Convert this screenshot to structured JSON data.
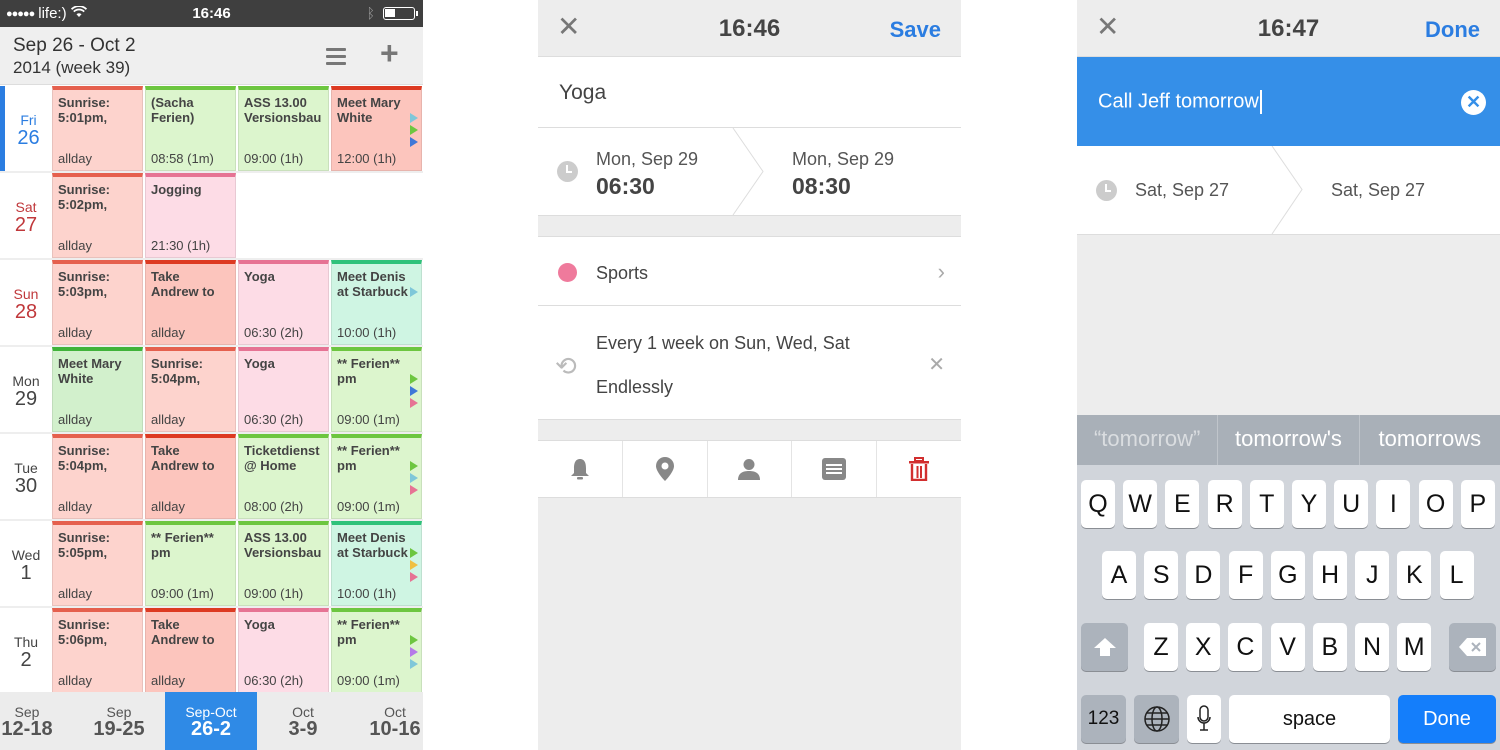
{
  "calendar": {
    "status_bar": {
      "carrier": "life:)",
      "signal": "●●●●●",
      "time": "16:46"
    },
    "header": {
      "range": "Sep 26 - Oct 2",
      "year_week": "2014 (week 39)"
    },
    "days": [
      {
        "dow": "Fri",
        "num": "26",
        "style": "today",
        "events": [
          {
            "title": "Sunrise:\n5:01pm,",
            "time": "allday",
            "color": "red"
          },
          {
            "title": "(Sacha\nFerien)",
            "time": "08:58 (1m)",
            "color": "green"
          },
          {
            "title": "ASS 13.00\nVersionsbau",
            "time": "09:00 (1h)",
            "color": "green"
          },
          {
            "title": "Meet Mary\nWhite",
            "time": "12:00 (1h)",
            "color": "redd"
          }
        ],
        "more": [
          "#7fc7d9",
          "#6dc640",
          "#3f78d8"
        ]
      },
      {
        "dow": "Sat",
        "num": "27",
        "style": "weekend",
        "events": [
          {
            "title": "Sunrise:\n5:02pm,",
            "time": "allday",
            "color": "red"
          },
          {
            "title": "Jogging",
            "time": "21:30 (1h)",
            "color": "pink"
          }
        ],
        "more": []
      },
      {
        "dow": "Sun",
        "num": "28",
        "style": "weekend",
        "events": [
          {
            "title": "Sunrise:\n5:03pm,",
            "time": "allday",
            "color": "red"
          },
          {
            "title": "Take\nAndrew to",
            "time": "allday",
            "color": "redd"
          },
          {
            "title": "Yoga",
            "time": "06:30 (2h)",
            "color": "pink"
          },
          {
            "title": "Meet Denis\nat Starbuck",
            "time": "10:00 (1h)",
            "color": "teal"
          }
        ],
        "more": [
          "#7fc7d9"
        ]
      },
      {
        "dow": "Mon",
        "num": "29",
        "style": "normal",
        "events": [
          {
            "title": "Meet Mary\nWhite",
            "time": "allday",
            "color": "greend"
          },
          {
            "title": "Sunrise:\n5:04pm,",
            "time": "allday",
            "color": "red"
          },
          {
            "title": "Yoga",
            "time": "06:30 (2h)",
            "color": "pink"
          },
          {
            "title": "** Ferien**\npm",
            "time": "09:00 (1m)",
            "color": "green"
          }
        ],
        "more": [
          "#6dc640",
          "#3f78d8",
          "#e67394"
        ]
      },
      {
        "dow": "Tue",
        "num": "30",
        "style": "normal",
        "events": [
          {
            "title": "Sunrise:\n5:04pm,",
            "time": "allday",
            "color": "red"
          },
          {
            "title": "Take\nAndrew to",
            "time": "allday",
            "color": "redd"
          },
          {
            "title": "Ticketdienst\n@ Home",
            "time": "08:00 (2h)",
            "color": "green"
          },
          {
            "title": "** Ferien**\npm",
            "time": "09:00 (1m)",
            "color": "green"
          }
        ],
        "more": [
          "#6dc640",
          "#7fc7d9",
          "#e67394"
        ]
      },
      {
        "dow": "Wed",
        "num": "1",
        "style": "normal",
        "events": [
          {
            "title": "Sunrise:\n5:05pm,",
            "time": "allday",
            "color": "red"
          },
          {
            "title": "** Ferien**\npm",
            "time": "09:00 (1m)",
            "color": "green"
          },
          {
            "title": "ASS 13.00\nVersionsbau",
            "time": "09:00 (1h)",
            "color": "green"
          },
          {
            "title": "Meet Denis\nat Starbuck",
            "time": "10:00 (1h)",
            "color": "teal"
          }
        ],
        "more": [
          "#6dc640",
          "#f0c040",
          "#e67394"
        ]
      },
      {
        "dow": "Thu",
        "num": "2",
        "style": "normal",
        "events": [
          {
            "title": "Sunrise:\n5:06pm,",
            "time": "allday",
            "color": "red"
          },
          {
            "title": "Take\nAndrew to",
            "time": "allday",
            "color": "redd"
          },
          {
            "title": "Yoga",
            "time": "06:30 (2h)",
            "color": "pink"
          },
          {
            "title": "** Ferien**\npm",
            "time": "09:00 (1m)",
            "color": "green"
          }
        ],
        "more": [
          "#6dc640",
          "#b57be8",
          "#7fc7d9"
        ]
      }
    ],
    "weeks": [
      {
        "month": "Sep",
        "range": "12-18",
        "selected": false
      },
      {
        "month": "Sep",
        "range": "19-25",
        "selected": false
      },
      {
        "month": "Sep-Oct",
        "range": "26-2",
        "selected": true
      },
      {
        "month": "Oct",
        "range": "3-9",
        "selected": false
      },
      {
        "month": "Oct",
        "range": "10-16",
        "selected": false
      }
    ]
  },
  "edit_event": {
    "title_bar": {
      "time": "16:46",
      "action": "Save"
    },
    "title": "Yoga",
    "start": {
      "date": "Mon, Sep 29",
      "time": "06:30"
    },
    "end": {
      "date": "Mon, Sep 29",
      "time": "08:30"
    },
    "category": {
      "label": "Sports",
      "color": "#ef7a9c"
    },
    "repeat": {
      "line1": "Every 1 week on Sun, Wed, Sat",
      "line2": "Endlessly"
    },
    "toolbar": [
      "bell",
      "location",
      "person",
      "notes",
      "trash"
    ]
  },
  "new_event": {
    "title_bar": {
      "time": "16:47",
      "action": "Done"
    },
    "title_input": "Call Jeff tomorrow",
    "start": {
      "date": "Sat, Sep 27"
    },
    "end": {
      "date": "Sat, Sep 27"
    },
    "suggestions": [
      "“tomorrow”",
      "tomorrow's",
      "tomorrows"
    ],
    "keyboard": {
      "row1": [
        "Q",
        "W",
        "E",
        "R",
        "T",
        "Y",
        "U",
        "I",
        "O",
        "P"
      ],
      "row2": [
        "A",
        "S",
        "D",
        "F",
        "G",
        "H",
        "J",
        "K",
        "L"
      ],
      "row3": [
        "Z",
        "X",
        "C",
        "V",
        "B",
        "N",
        "M"
      ],
      "num_key": "123",
      "space_key": "space",
      "done_key": "Done"
    }
  }
}
